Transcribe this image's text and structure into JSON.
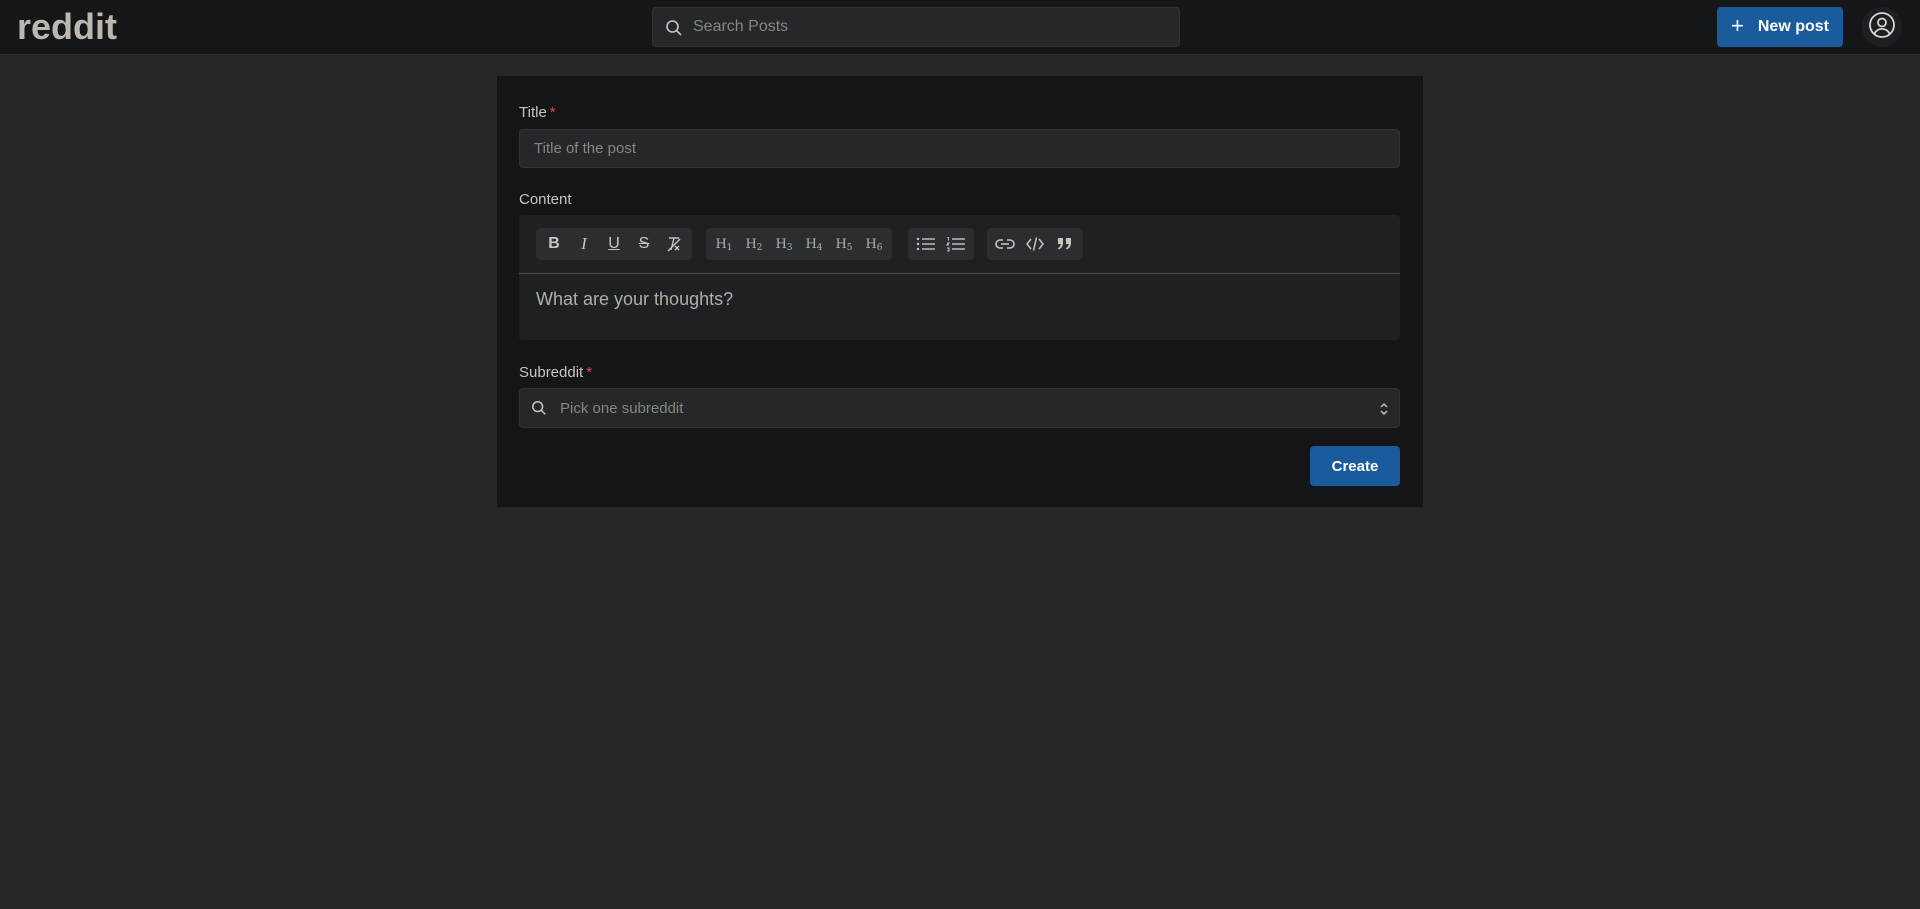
{
  "header": {
    "logo": "reddit",
    "search_placeholder": "Search Posts",
    "new_post_label": "New post"
  },
  "form": {
    "title_label": "Title",
    "title_required": "*",
    "title_placeholder": "Title of the post",
    "content_label": "Content",
    "content_placeholder": "What are your thoughts?",
    "subreddit_label": "Subreddit",
    "subreddit_required": "*",
    "subreddit_placeholder": "Pick one subreddit",
    "create_label": "Create"
  },
  "toolbar": {
    "format_buttons": [
      "bold",
      "italic",
      "underline",
      "strikethrough",
      "clear-formatting"
    ],
    "heading_buttons": [
      "H1",
      "H2",
      "H3",
      "H4",
      "H5",
      "H6"
    ],
    "list_buttons": [
      "bullet-list",
      "ordered-list"
    ],
    "insert_buttons": [
      "link",
      "code",
      "blockquote"
    ]
  },
  "colors": {
    "accent": "#1a5b9e",
    "background": "#25282a",
    "card": "#131516",
    "required": "#e5484d"
  }
}
